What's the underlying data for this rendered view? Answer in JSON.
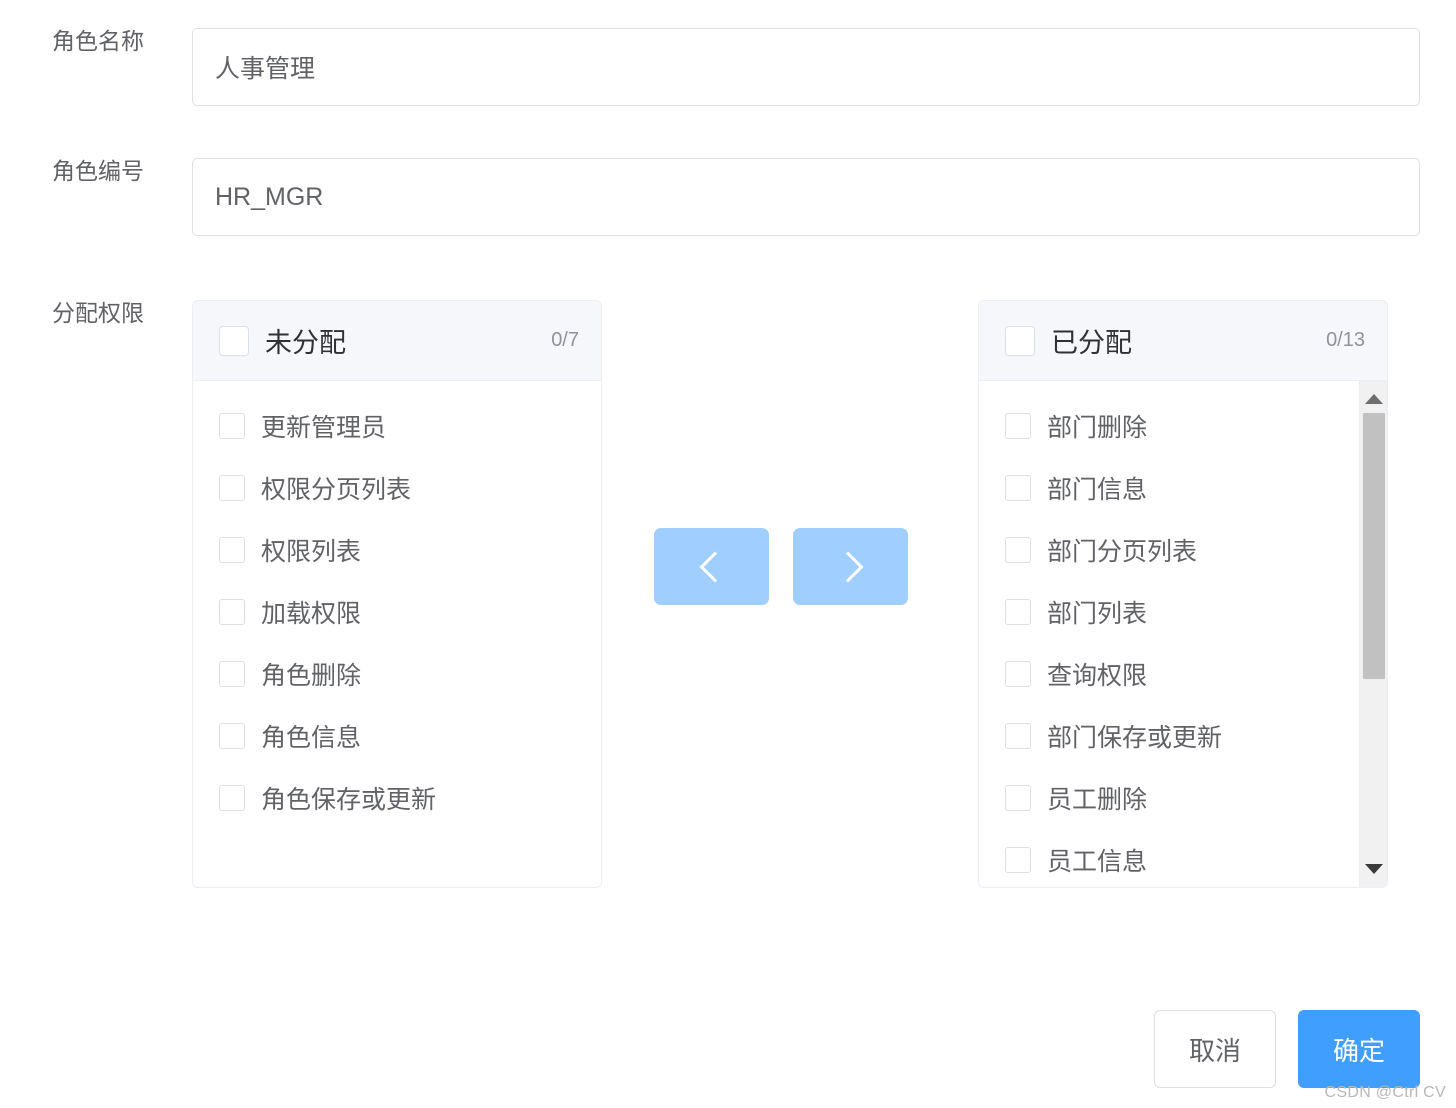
{
  "form": {
    "fields": [
      {
        "label": "角色名称",
        "value": "人事管理",
        "name": "role-name"
      },
      {
        "label": "角色编号",
        "value": "HR_MGR",
        "name": "role-code"
      }
    ],
    "permission_label": "分配权限"
  },
  "transfer": {
    "left_panel": {
      "title": "未分配",
      "count": "0/7",
      "items": [
        "更新管理员",
        "权限分页列表",
        "权限列表",
        "加载权限",
        "角色删除",
        "角色信息",
        "角色保存或更新"
      ]
    },
    "right_panel": {
      "title": "已分配",
      "count": "0/13",
      "items": [
        "部门删除",
        "部门信息",
        "部门分页列表",
        "部门列表",
        "查询权限",
        "部门保存或更新",
        "员工删除",
        "员工信息"
      ]
    },
    "buttons": {
      "to_left_icon": "chevron-left-icon",
      "to_right_icon": "chevron-right-icon"
    }
  },
  "footer": {
    "cancel_label": "取消",
    "confirm_label": "确定"
  },
  "watermark": "CSDN @Ctrl CV",
  "colors": {
    "primary": "#409eff",
    "primary_disabled": "#a0cfff",
    "border": "#dcdfe6",
    "panel_header_bg": "#f5f7fa",
    "text_regular": "#606266",
    "text_secondary": "#909399"
  }
}
